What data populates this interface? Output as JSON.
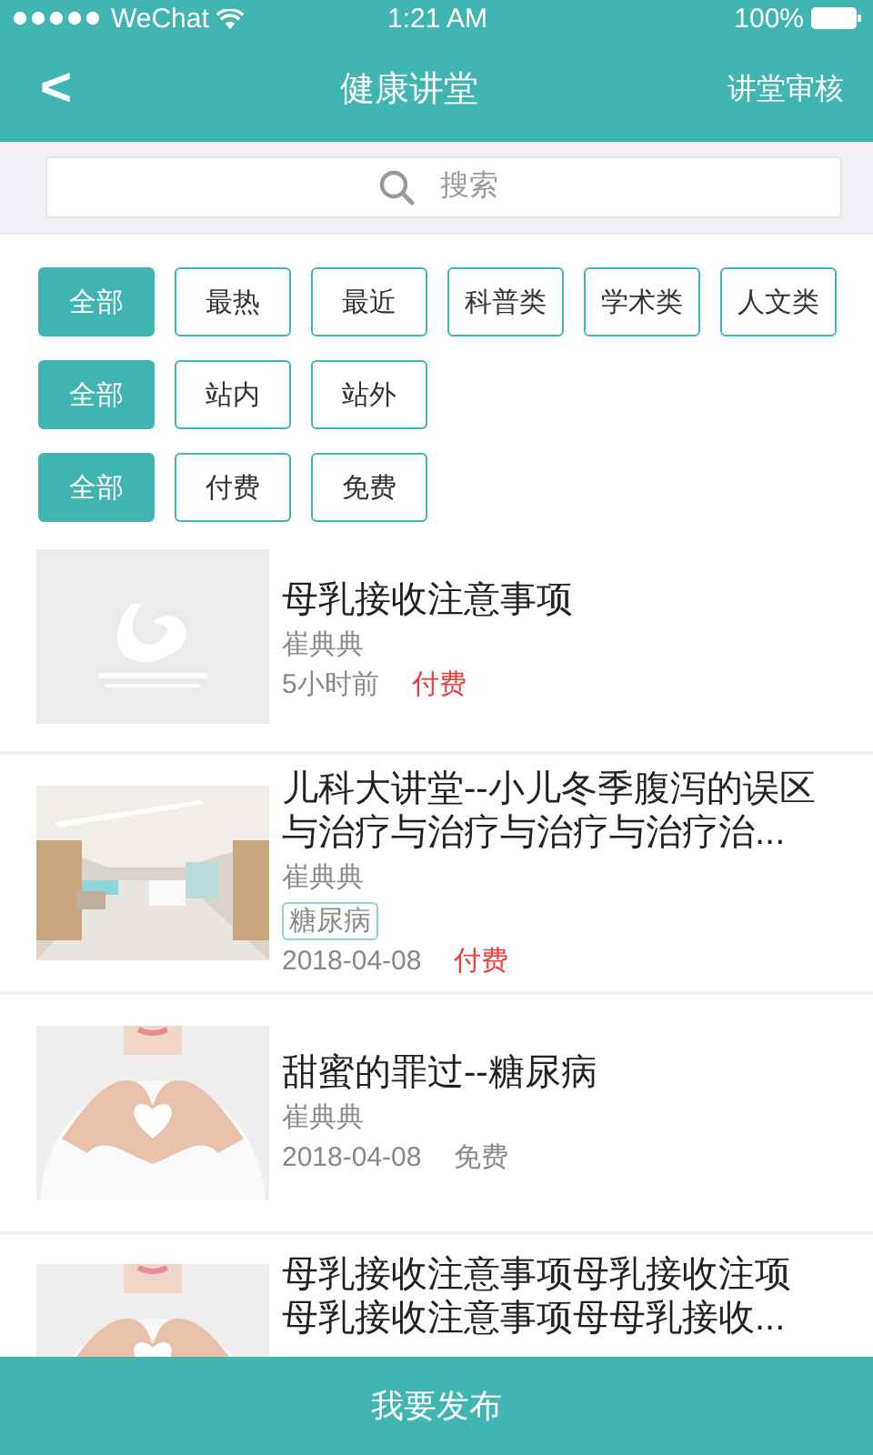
{
  "status_bar": {
    "carrier": "WeChat",
    "time": "1:21 AM",
    "battery": "100%"
  },
  "nav": {
    "back": "<",
    "title": "健康讲堂",
    "action": "讲堂审核"
  },
  "search": {
    "placeholder": "搜索"
  },
  "filters": [
    {
      "options": [
        {
          "label": "全部",
          "selected": true
        },
        {
          "label": "最热",
          "selected": false
        },
        {
          "label": "最近",
          "selected": false
        },
        {
          "label": "科普类",
          "selected": false
        },
        {
          "label": "学术类",
          "selected": false
        },
        {
          "label": "人文类",
          "selected": false
        }
      ]
    },
    {
      "options": [
        {
          "label": "全部",
          "selected": true
        },
        {
          "label": "站内",
          "selected": false
        },
        {
          "label": "站外",
          "selected": false
        }
      ]
    },
    {
      "options": [
        {
          "label": "全部",
          "selected": true
        },
        {
          "label": "付费",
          "selected": false
        },
        {
          "label": "免费",
          "selected": false
        }
      ]
    }
  ],
  "lectures": [
    {
      "title": "母乳接收注意事项",
      "author": "崔典典",
      "date": "5小时前",
      "price": {
        "label": "付费",
        "paid": true
      }
    },
    {
      "title": "儿科大讲堂--小儿冬季腹泻的误区与治疗与治疗与治疗与治疗治...",
      "author": "崔典典",
      "tag": "糖尿病",
      "date": "2018-04-08",
      "price": {
        "label": "付费",
        "paid": true
      }
    },
    {
      "title": "甜蜜的罪过--糖尿病",
      "author": "崔典典",
      "date": "2018-04-08",
      "price": {
        "label": "免费",
        "paid": false
      }
    },
    {
      "title": "母乳接收注意事项母乳接收注项母乳接收注意事项母母乳接收..."
    }
  ],
  "publish_button": "我要发布"
}
